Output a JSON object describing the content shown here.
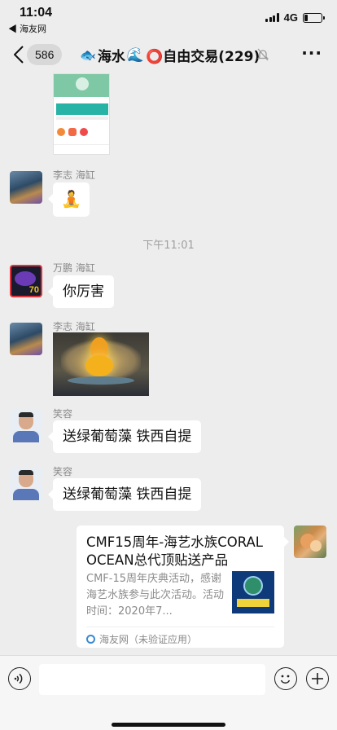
{
  "status": {
    "time": "11:04",
    "back_app": "◀ 海友网",
    "network": "4G",
    "battery_level": 0.2
  },
  "header": {
    "unread_count": "586",
    "title": "海水",
    "title_middle": "⭕自由交易(229)"
  },
  "messages": [
    {
      "sender": "李志 海缸"
    },
    {
      "sender": "万鹏 海缸",
      "text": "你厉害"
    },
    {
      "sender": "李志 海缸"
    },
    {
      "sender": "笑容",
      "text": "送绿葡萄藻  铁西自提"
    },
    {
      "sender": "笑容",
      "text": "送绿葡萄藻  铁西自提"
    }
  ],
  "timestamp": "下午11:01",
  "link_card": {
    "title": "CMF15周年-海艺水族CORAL OCEAN总代顶贴送产品",
    "description": "CMF-15周年庆典活动，感谢海艺水族参与此次活动。活动时间：2020年7...",
    "source": "海友网（未验证应用）"
  },
  "colors": {
    "background": "#ededed",
    "bubble": "#ffffff",
    "muted_text": "#8a8a8a"
  }
}
